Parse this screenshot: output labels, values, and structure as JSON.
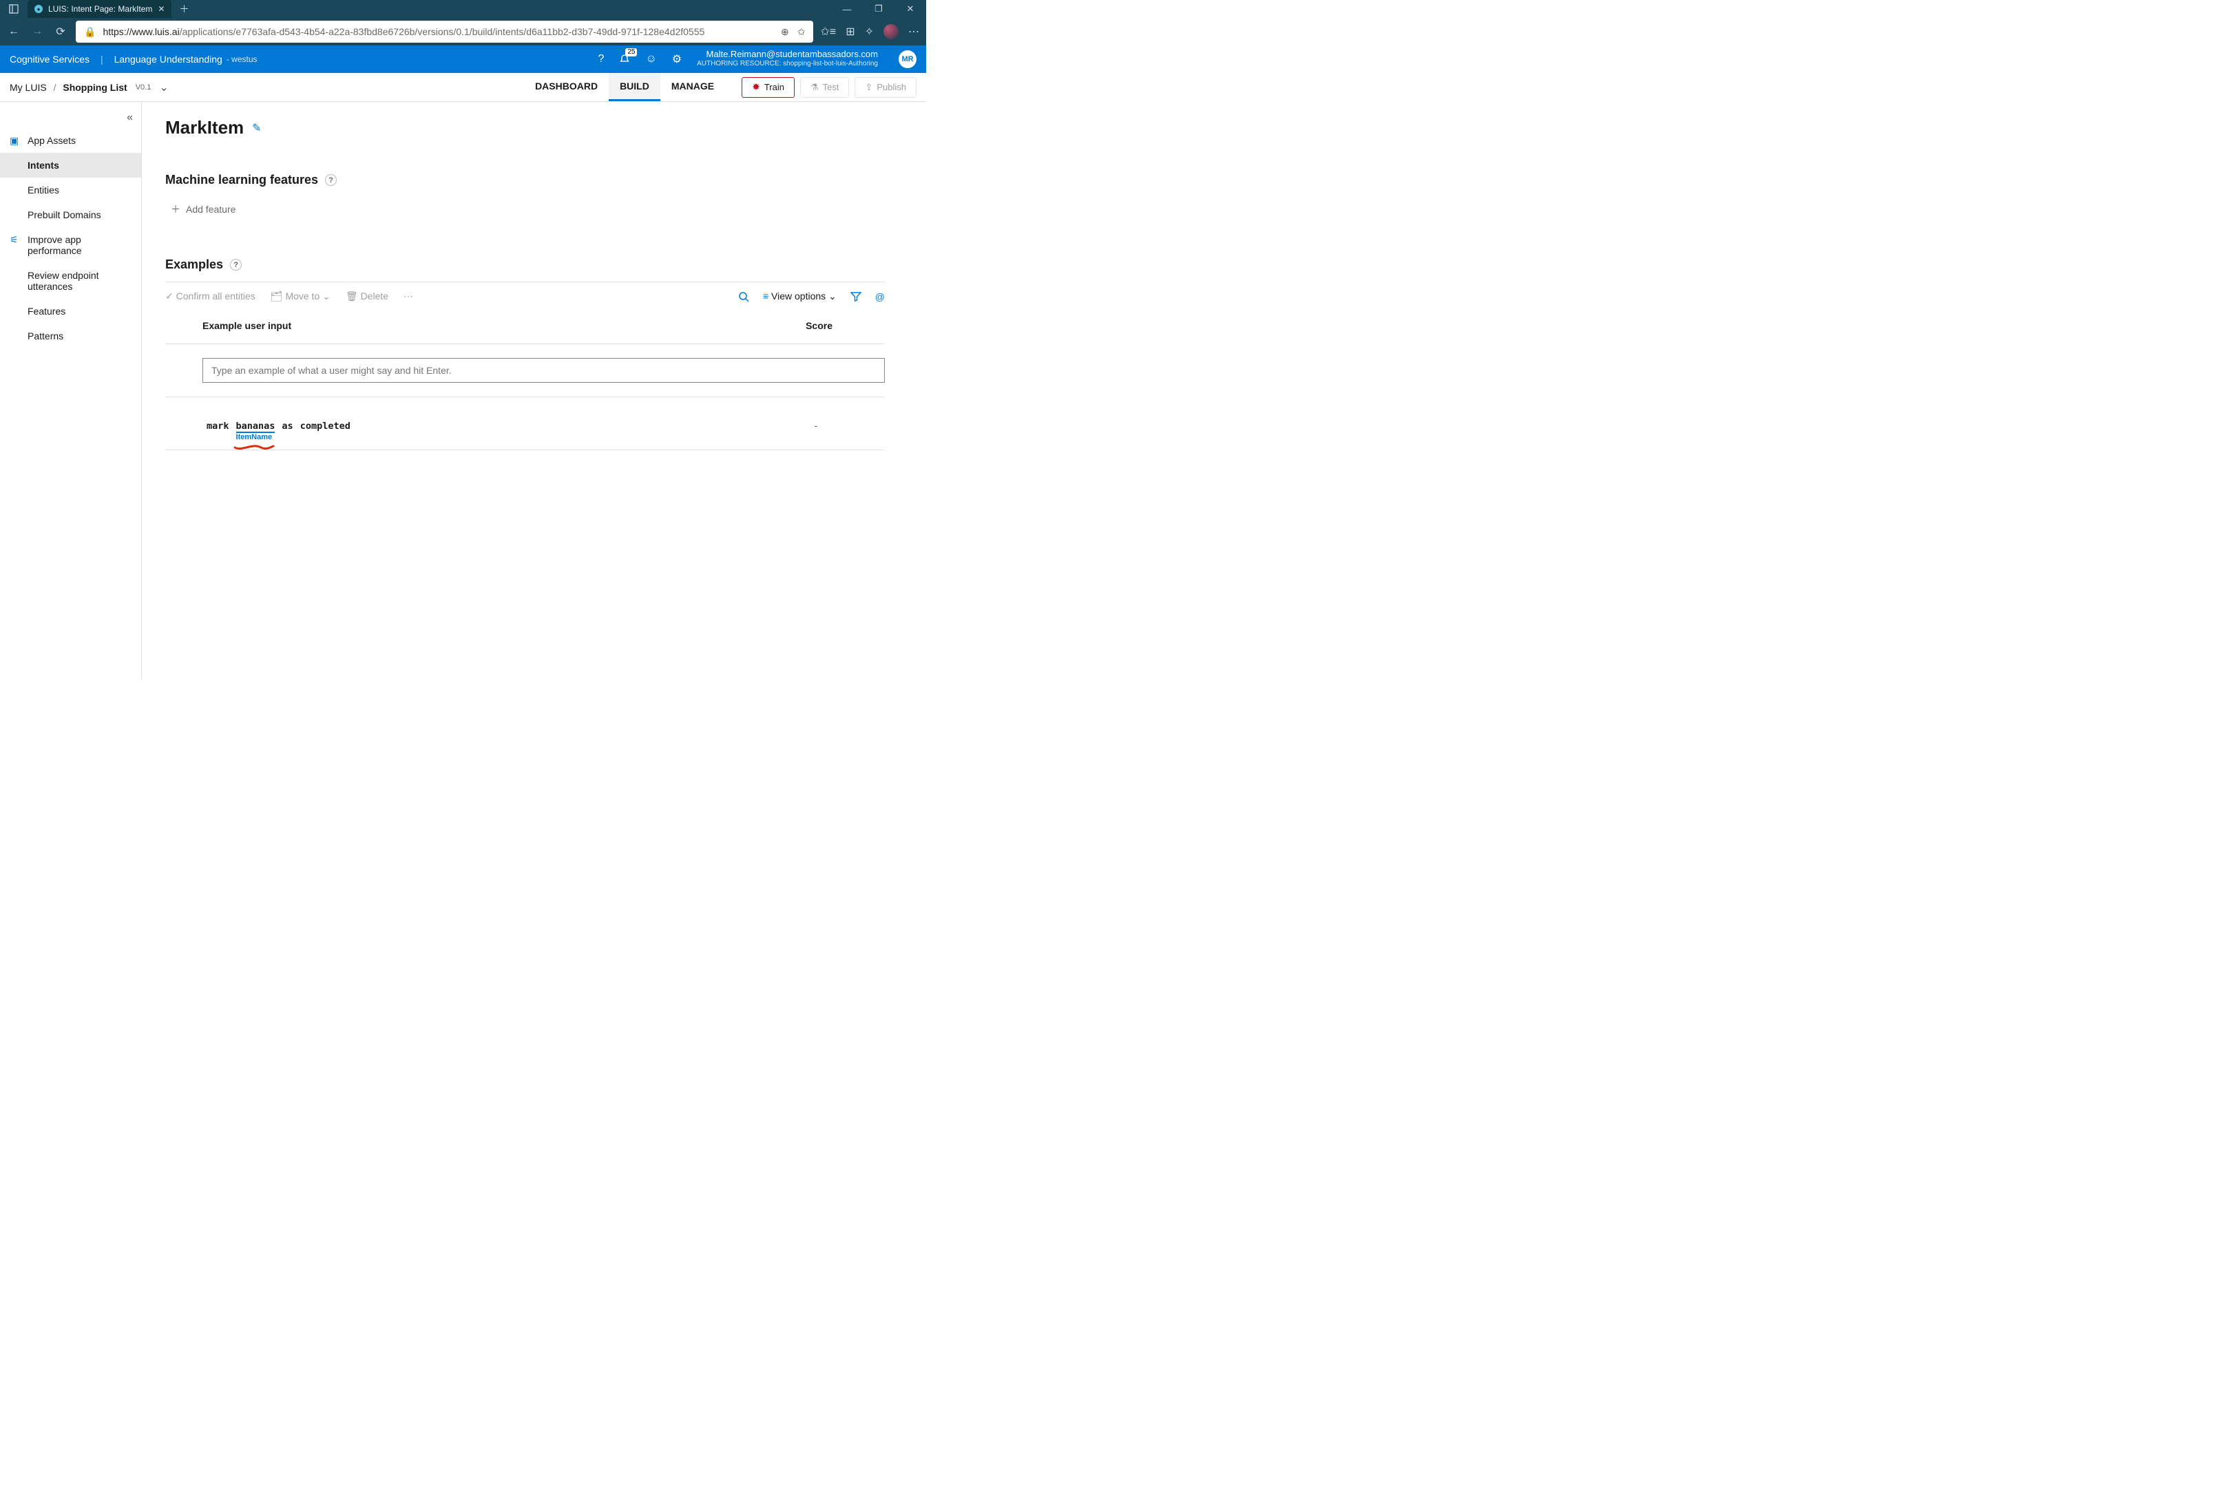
{
  "browser": {
    "tab_title": "LUIS: Intent Page: MarkItem",
    "url_host": "https://www.luis.ai",
    "url_path": "/applications/e7763afa-d543-4b54-a22a-83fbd8e6726b/versions/0.1/build/intents/d6a11bb2-d3b7-49dd-971f-128e4d2f0555"
  },
  "azure_header": {
    "brand": "Cognitive Services",
    "product": "Language Understanding",
    "region": "- westus",
    "notification_count": "25",
    "user_email": "Malte.Reimann@studentambassadors.com",
    "resource_prefix": "AUTHORING RESOURCE:",
    "resource_name": "shopping-list-bot-luis-Authoring",
    "avatar_initials": "MR"
  },
  "breadcrumb": {
    "root": "My LUIS",
    "app": "Shopping List",
    "version": "V0.1"
  },
  "tabs": {
    "dashboard": "DASHBOARD",
    "build": "BUILD",
    "manage": "MANAGE"
  },
  "action_buttons": {
    "train": "Train",
    "test": "Test",
    "publish": "Publish"
  },
  "sidebar": {
    "group_assets": "App Assets",
    "intents": "Intents",
    "entities": "Entities",
    "prebuilt": "Prebuilt Domains",
    "group_improve": "Improve app performance",
    "review": "Review endpoint utterances",
    "features": "Features",
    "patterns": "Patterns"
  },
  "page": {
    "title": "MarkItem",
    "ml_heading": "Machine learning features",
    "add_feature": "Add feature",
    "examples_heading": "Examples"
  },
  "examples_toolbar": {
    "confirm": "Confirm all entities",
    "moveto": "Move to",
    "delete": "Delete",
    "view_options": "View options"
  },
  "columns": {
    "input": "Example user input",
    "score": "Score"
  },
  "input_placeholder": "Type an example of what a user might say and hit Enter.",
  "utterance": {
    "w1": "mark",
    "w2": "bananas",
    "w3": "as",
    "w4": "completed",
    "entity_label": "ItemName",
    "score": "-"
  }
}
